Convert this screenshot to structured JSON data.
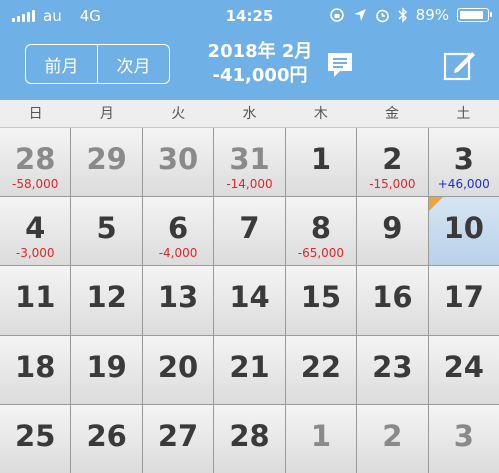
{
  "status_bar": {
    "carrier": "au",
    "network": "4G",
    "time": "14:25",
    "battery": "89%",
    "battery_level": 0.89
  },
  "header": {
    "prev_label": "前月",
    "next_label": "次月",
    "title_month": "2018年 2月",
    "title_total": "-41,000円"
  },
  "weekdays": [
    "日",
    "月",
    "火",
    "水",
    "木",
    "金",
    "土"
  ],
  "days": [
    {
      "day": "28",
      "amount": "-58,000",
      "other": true
    },
    {
      "day": "29",
      "amount": "",
      "other": true
    },
    {
      "day": "30",
      "amount": "",
      "other": true
    },
    {
      "day": "31",
      "amount": "-14,000",
      "other": true
    },
    {
      "day": "1",
      "amount": ""
    },
    {
      "day": "2",
      "amount": "-15,000"
    },
    {
      "day": "3",
      "amount": "+46,000"
    },
    {
      "day": "4",
      "amount": "-3,000"
    },
    {
      "day": "5",
      "amount": ""
    },
    {
      "day": "6",
      "amount": "-4,000"
    },
    {
      "day": "7",
      "amount": ""
    },
    {
      "day": "8",
      "amount": "-65,000"
    },
    {
      "day": "9",
      "amount": ""
    },
    {
      "day": "10",
      "amount": "",
      "today": true
    },
    {
      "day": "11",
      "amount": ""
    },
    {
      "day": "12",
      "amount": ""
    },
    {
      "day": "13",
      "amount": ""
    },
    {
      "day": "14",
      "amount": ""
    },
    {
      "day": "15",
      "amount": ""
    },
    {
      "day": "16",
      "amount": ""
    },
    {
      "day": "17",
      "amount": ""
    },
    {
      "day": "18",
      "amount": ""
    },
    {
      "day": "19",
      "amount": ""
    },
    {
      "day": "20",
      "amount": ""
    },
    {
      "day": "21",
      "amount": ""
    },
    {
      "day": "22",
      "amount": ""
    },
    {
      "day": "23",
      "amount": ""
    },
    {
      "day": "24",
      "amount": ""
    },
    {
      "day": "25",
      "amount": ""
    },
    {
      "day": "26",
      "amount": ""
    },
    {
      "day": "27",
      "amount": ""
    },
    {
      "day": "28",
      "amount": ""
    },
    {
      "day": "1",
      "amount": "",
      "other": true
    },
    {
      "day": "2",
      "amount": "",
      "other": true
    },
    {
      "day": "3",
      "amount": "",
      "other": true
    }
  ],
  "colors": {
    "header": "#6fb0e6",
    "expense": "#e0262a",
    "income": "#1a2fd1",
    "today_marker": "#e9a640"
  }
}
